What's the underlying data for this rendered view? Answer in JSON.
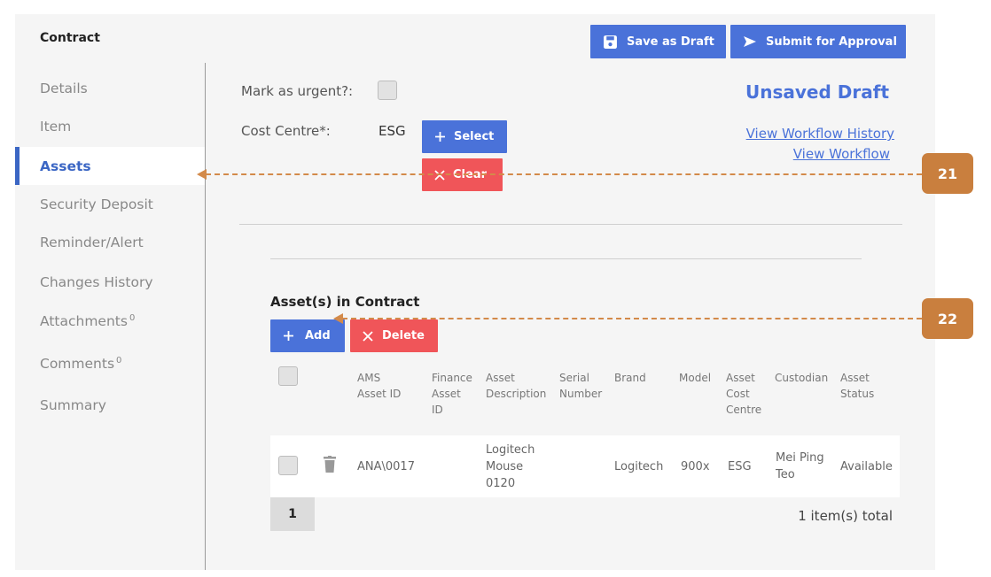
{
  "header": {
    "title": "Contract",
    "save_draft_label": "Save as Draft",
    "submit_label": "Submit for Approval"
  },
  "sidebar": {
    "items": [
      {
        "label": "Details"
      },
      {
        "label": "Item"
      },
      {
        "label": "Assets",
        "active": true
      },
      {
        "label": "Security Deposit"
      },
      {
        "label": "Reminder/Alert"
      },
      {
        "label": "Changes History"
      },
      {
        "label": "Attachments",
        "count": "0"
      },
      {
        "label": "Comments",
        "count": "0"
      },
      {
        "label": "Summary"
      }
    ]
  },
  "form": {
    "urgent_label": "Mark as urgent?:",
    "urgent_checked": false,
    "cost_centre_label": "Cost Centre*:",
    "cost_centre_value": "ESG",
    "select_label": "Select",
    "clear_label": "Clear",
    "status": "Unsaved Draft",
    "workflow_history_link": "View Workflow History",
    "workflow_link": "View Workflow"
  },
  "assets": {
    "section_title": "Asset(s) in Contract",
    "add_label": "Add",
    "delete_label": "Delete",
    "columns": [
      "AMS Asset ID",
      "Finance Asset ID",
      "Asset Description",
      "Serial Number",
      "Brand",
      "Model",
      "Asset Cost Centre",
      "Custodian",
      "Asset Status"
    ],
    "rows": [
      {
        "ams_asset_id": "ANA\\0017",
        "finance_asset_id": "",
        "description": "Logitech Mouse 0120",
        "serial_number": "",
        "brand": "Logitech",
        "model": "900x",
        "cost_centre": "ESG",
        "custodian": "Mei Ping Teo",
        "status": "Available"
      }
    ],
    "page": "1",
    "total_text": "1 item(s) total"
  },
  "callouts": {
    "first": "21",
    "second": "22"
  },
  "colors": {
    "primary": "#4a72d9",
    "danger": "#f05559",
    "callout": "#c97f3e"
  }
}
